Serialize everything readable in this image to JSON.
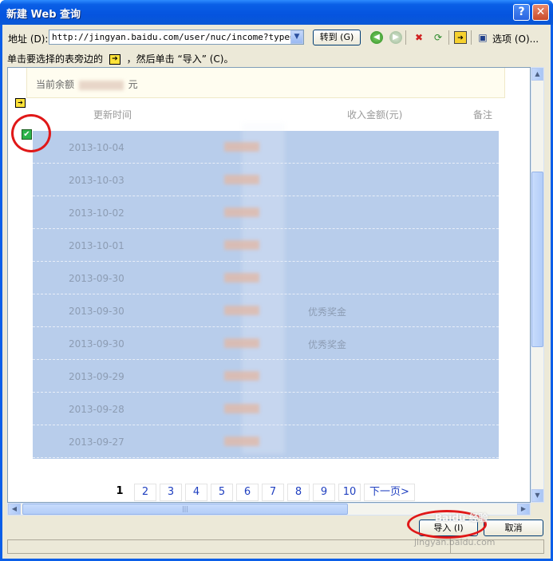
{
  "window": {
    "title": "新建 Web 查询"
  },
  "titlebar": {
    "help": "?",
    "close": "✕"
  },
  "toolbar": {
    "address_label": "地址 (D):",
    "address_value": "http://jingyan.baidu.com/user/nuc/income?type=2",
    "dropdown": "▼",
    "goto_label": "转到 (G)",
    "options_label": "选项 (O)...",
    "icons": [
      "back-icon",
      "forward-icon",
      "stop-icon",
      "refresh-icon",
      "select-tables-icon",
      "save-query-icon"
    ]
  },
  "hint": {
    "prefix": "单击要选择的表旁边的",
    "suffix": "，然后单击 “导入” (C)。",
    "arrow": "➔"
  },
  "content": {
    "balance_label": "当前余额",
    "balance_unit": "元",
    "table_arrow": "➔",
    "headers": {
      "time": "更新时间",
      "income": "收入金额(元)",
      "note": "备注"
    },
    "checkbox": "✔",
    "rows": [
      {
        "date": "2013-10-04",
        "note": ""
      },
      {
        "date": "2013-10-03",
        "note": ""
      },
      {
        "date": "2013-10-02",
        "note": ""
      },
      {
        "date": "2013-10-01",
        "note": ""
      },
      {
        "date": "2013-09-30",
        "note": ""
      },
      {
        "date": "2013-09-30",
        "note": "优秀奖金"
      },
      {
        "date": "2013-09-30",
        "note": "优秀奖金"
      },
      {
        "date": "2013-09-29",
        "note": ""
      },
      {
        "date": "2013-09-28",
        "note": ""
      },
      {
        "date": "2013-09-27",
        "note": ""
      }
    ],
    "pager": {
      "pages": [
        "1",
        "2",
        "3",
        "4",
        "5",
        "6",
        "7",
        "8",
        "9",
        "10"
      ],
      "current": "1",
      "next": "下一页>"
    }
  },
  "buttons": {
    "import": "导入 (I)",
    "cancel": "取消"
  },
  "watermark": {
    "brand": "Baidu 经验",
    "url": "jingyan.baidu.com"
  },
  "colors": {
    "titlebar": "#0554df",
    "table_selected": "#b8cdeb",
    "highlight_circle": "#e01818"
  }
}
